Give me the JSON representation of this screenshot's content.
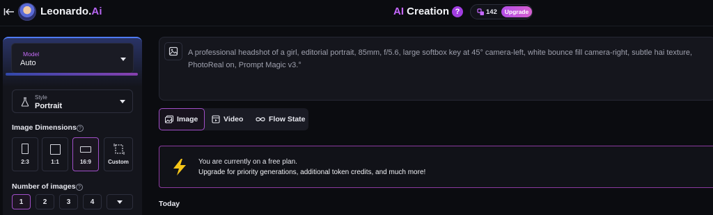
{
  "header": {
    "brand_name": "Leonardo.",
    "brand_suffix": "Ai",
    "title_accent": "AI",
    "title_rest": " Creation",
    "help_label": "?",
    "token_count": "142",
    "upgrade_label": "Upgrade"
  },
  "sidebar": {
    "model": {
      "label": "Model",
      "value": "Auto"
    },
    "style": {
      "label": "Style",
      "value": "Portrait"
    },
    "dimensions": {
      "heading": "Image Dimensions",
      "options": [
        {
          "label": "2:3",
          "selected": false
        },
        {
          "label": "1:1",
          "selected": false
        },
        {
          "label": "16:9",
          "selected": true
        },
        {
          "label": "Custom",
          "selected": false
        }
      ]
    },
    "num_images": {
      "heading": "Number of images",
      "options": [
        "1",
        "2",
        "3",
        "4"
      ],
      "selected": "1"
    }
  },
  "main": {
    "prompt": "A professional headshot of a girl, editorial portrait, 85mm, f/5.6, large softbox key at 45° camera-left, white bounce fill camera-right, subtle hai texture, PhotoReal on, Prompt Magic v3.°",
    "tabs": [
      {
        "label": "Image",
        "icon": "image-icon",
        "active": true
      },
      {
        "label": "Video",
        "icon": "video-icon",
        "active": false
      },
      {
        "label": "Flow State",
        "icon": "infinity-icon",
        "active": false
      }
    ],
    "banner": {
      "line1": "You are currently on a free plan.",
      "line2": "Upgrade for priority generations, additional token credits, and much more!"
    },
    "today_label": "Today"
  },
  "colors": {
    "background": "#0b0c10",
    "panel": "#14151c",
    "accent_purple": "#b766f2",
    "selected_border": "#a14fc9",
    "bolt_yellow": "#f5c518"
  }
}
